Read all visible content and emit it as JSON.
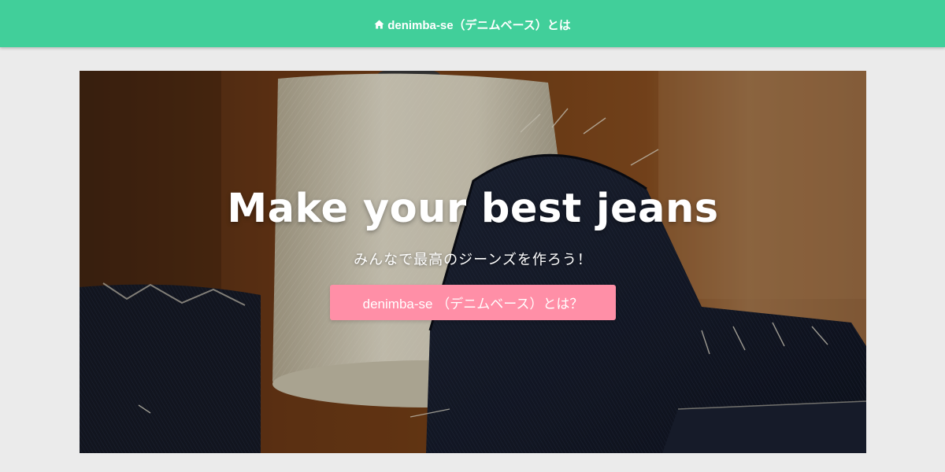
{
  "header": {
    "site_title": "denimba-se（デニムベース）とは",
    "icon": "home-icon",
    "background_color": "#41cf9a"
  },
  "hero": {
    "image": "thread-cone-and-denim-fabric-photo",
    "headline": "Make your best jeans",
    "subheadline": "みんなで最高のジーンズを作ろう！",
    "cta_label": "denimba-se （デニムベース）とは？",
    "cta_color": "#ff8fa7"
  },
  "page": {
    "background_color": "#ebebeb"
  }
}
